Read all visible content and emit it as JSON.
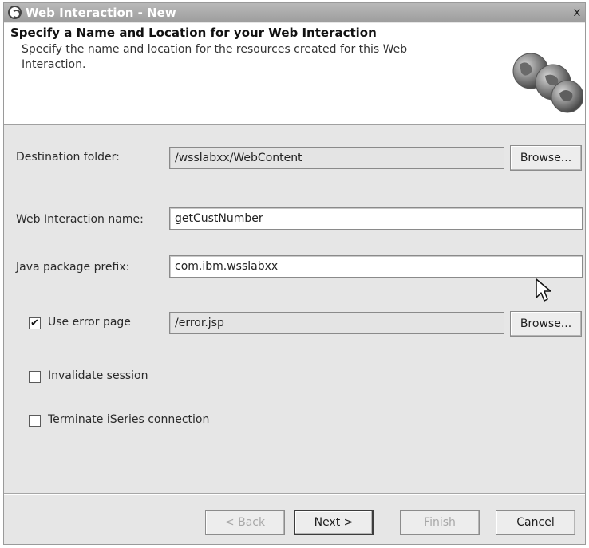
{
  "window": {
    "title": "Web Interaction - New",
    "close_glyph": "x"
  },
  "header": {
    "title": "Specify a Name and Location for your Web Interaction",
    "description": "Specify the name and location for the resources created for this Web Interaction.",
    "banner_icon": "globes-icon"
  },
  "form": {
    "destination_folder": {
      "label": "Destination folder:",
      "value": "/wsslabxx/WebContent",
      "browse_label": "Browse..."
    },
    "web_interaction_name": {
      "label": "Web Interaction name:",
      "value": "getCustNumber"
    },
    "java_package_prefix": {
      "label": "Java package prefix:",
      "value": "com.ibm.wsslabxx"
    },
    "use_error_page": {
      "label": "Use error page",
      "checked": true,
      "value": "/error.jsp",
      "browse_label": "Browse..."
    },
    "invalidate_session": {
      "label": "Invalidate session",
      "checked": false
    },
    "terminate_connection": {
      "label": "Terminate iSeries connection",
      "checked": false
    }
  },
  "buttons": {
    "back": "< Back",
    "next": "Next >",
    "finish": "Finish",
    "cancel": "Cancel"
  },
  "colors": {
    "titlebar": "#a9a9a9",
    "dialog_bg": "#e6e6e6",
    "header_bg": "#ffffff"
  }
}
